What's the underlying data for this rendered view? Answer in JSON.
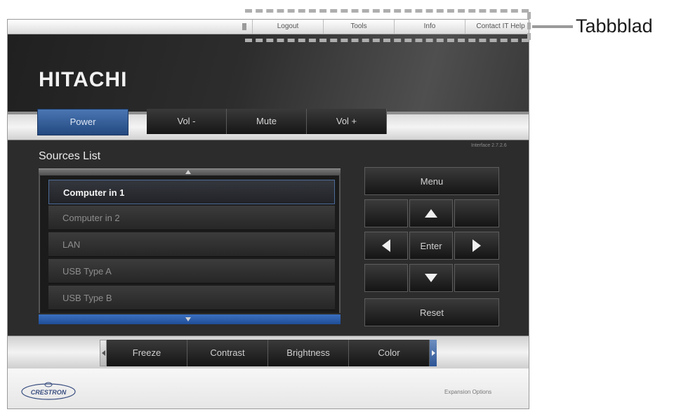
{
  "top_tabs": [
    "Logout",
    "Tools",
    "Info",
    "Contact IT Help"
  ],
  "brand": "HITACHI",
  "power_label": "Power",
  "volume_buttons": [
    "Vol -",
    "Mute",
    "Vol +"
  ],
  "interface_version": "Interface 2.7.2.6",
  "sources": {
    "title": "Sources List",
    "items": [
      "Computer in 1",
      "Computer in 2",
      "LAN",
      "USB Type A",
      "USB Type B"
    ],
    "selected": "Computer in 1"
  },
  "nav": {
    "menu": "Menu",
    "enter": "Enter",
    "reset": "Reset"
  },
  "adjust_buttons": [
    "Freeze",
    "Contrast",
    "Brightness",
    "Color"
  ],
  "footer": {
    "logo_text": "CRESTRON",
    "expansion": "Expansion Options"
  },
  "callout": {
    "label": "Tabbblad"
  },
  "colors": {
    "accent_blue": "#23497f",
    "list_scroll": "#2a5caa",
    "panel_dark": "#2c2c2c"
  },
  "icons": [
    "scroll-up-icon",
    "scroll-down-icon",
    "arrow-up-icon",
    "arrow-down-icon",
    "arrow-left-icon",
    "arrow-right-icon",
    "crestron-logo-icon"
  ]
}
